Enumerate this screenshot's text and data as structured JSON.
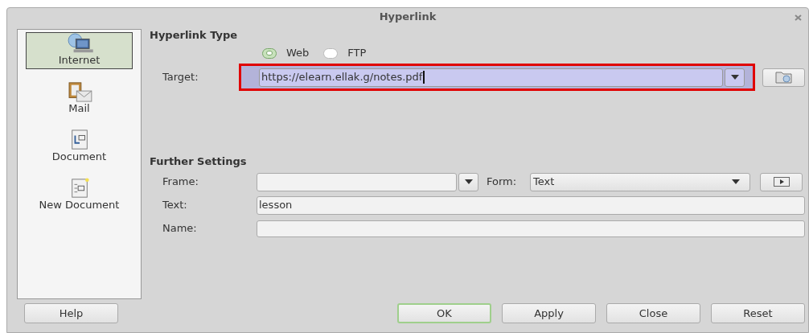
{
  "window": {
    "title": "Hyperlink"
  },
  "sidebar": {
    "items": [
      {
        "label": "Internet",
        "kind": "internet",
        "selected": true
      },
      {
        "label": "Mail",
        "kind": "mail",
        "selected": false
      },
      {
        "label": "Document",
        "kind": "document",
        "selected": false
      },
      {
        "label": "New Document",
        "kind": "new-document",
        "selected": false
      }
    ]
  },
  "hyperlink_type": {
    "heading": "Hyperlink Type",
    "radios": [
      {
        "label": "Web",
        "selected": true
      },
      {
        "label": "FTP",
        "selected": false
      }
    ],
    "target": {
      "label": "Target:",
      "value": "https://elearn.ellak.g/notes.pdf",
      "highlighted": true
    }
  },
  "further_settings": {
    "heading": "Further Settings",
    "frame": {
      "label": "Frame:"
    },
    "form": {
      "label": "Form:",
      "value": "Text"
    },
    "text": {
      "label": "Text:",
      "value": "lesson"
    },
    "name": {
      "label": "Name:"
    }
  },
  "buttons": [
    {
      "label": "Help",
      "default": false
    },
    {
      "label": "OK",
      "default": true
    },
    {
      "label": "Apply",
      "default": false
    },
    {
      "label": "Close",
      "default": false
    },
    {
      "label": "Reset",
      "default": false
    }
  ]
}
